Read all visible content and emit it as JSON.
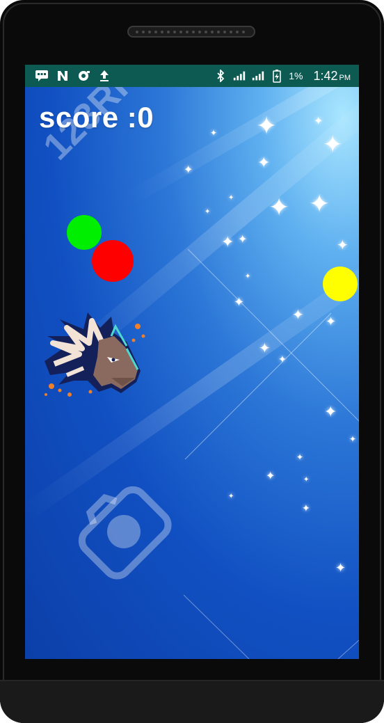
{
  "statusbar": {
    "battery_percent": "1%",
    "time": "1:42",
    "ampm": "PM",
    "icons": [
      "chat-icon",
      "n-icon",
      "camera-sync-icon",
      "upload-icon",
      "bluetooth-icon",
      "signal-icon",
      "signal-icon",
      "battery-charging-icon"
    ]
  },
  "game": {
    "score_text": "score :0",
    "balls": [
      {
        "color": "#00ee00",
        "name": "green-ball"
      },
      {
        "color": "#ff0000",
        "name": "red-ball"
      },
      {
        "color": "#ffff00",
        "name": "yellow-ball"
      }
    ],
    "player": "dragon-head-sprite",
    "watermark": "123RF"
  }
}
